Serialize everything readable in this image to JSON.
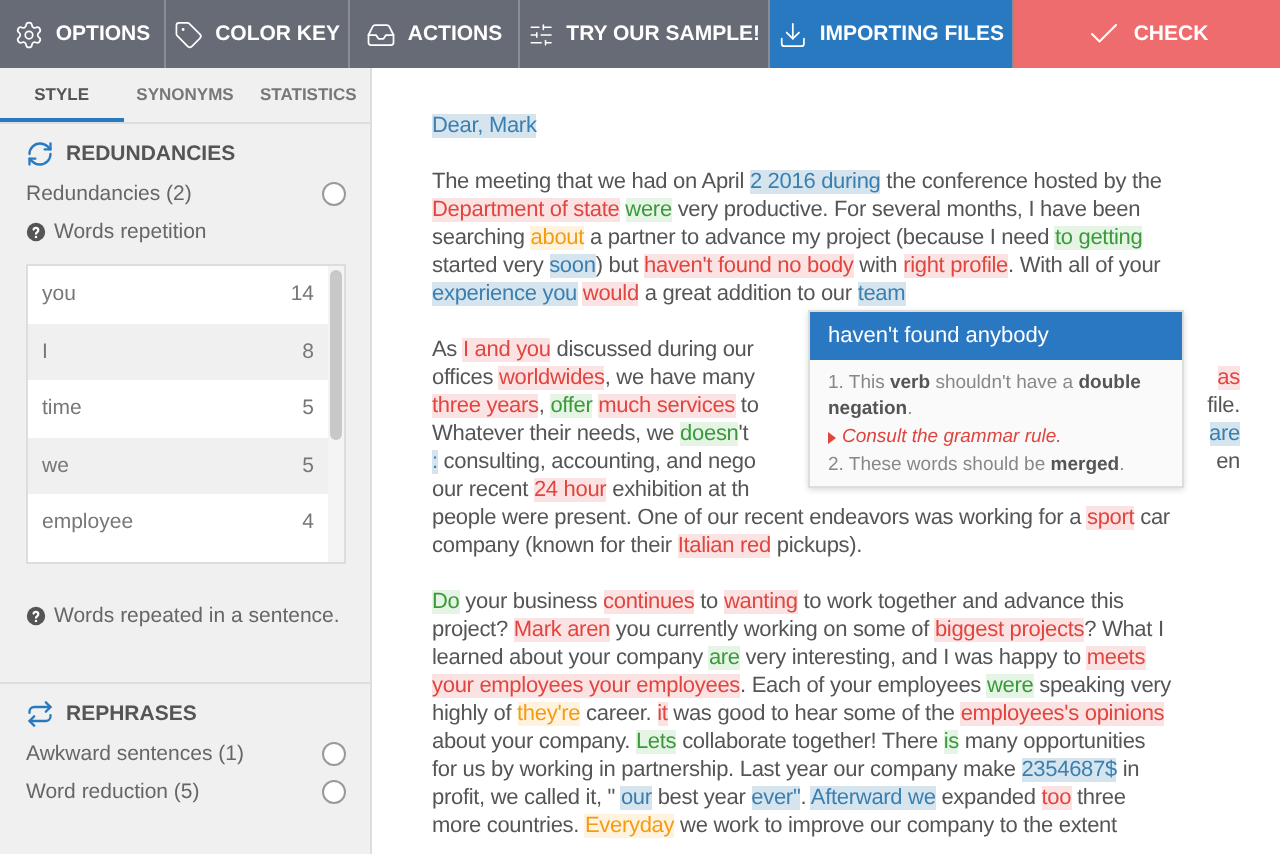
{
  "toolbar": [
    {
      "label": "OPTIONS",
      "kind": "gear"
    },
    {
      "label": "COLOR KEY",
      "kind": "tag"
    },
    {
      "label": "ACTIONS",
      "kind": "tray"
    },
    {
      "label": "TRY OUR SAMPLE!",
      "kind": "sliders"
    },
    {
      "label": "IMPORTING FILES",
      "kind": "download"
    },
    {
      "label": "CHECK",
      "kind": "check"
    }
  ],
  "sidebar": {
    "tabs": [
      {
        "label": "STYLE",
        "selected": true
      },
      {
        "label": "SYNONYMS",
        "selected": false
      },
      {
        "label": "STATISTICS",
        "selected": false
      }
    ],
    "sections": [
      {
        "title": "REDUNDANCIES",
        "kind": "redundancies",
        "options": [
          {
            "label": "Redundancies (2)",
            "checked": false
          }
        ],
        "help": "Words repetition",
        "words": [
          {
            "word": "you",
            "count": "14"
          },
          {
            "word": "I",
            "count": "8"
          },
          {
            "word": "time",
            "count": "5"
          },
          {
            "word": "we",
            "count": "5"
          },
          {
            "word": "employee",
            "count": "4"
          }
        ],
        "note": "Words repeated in a sentence."
      },
      {
        "title": "REPHRASES",
        "kind": "rephrases",
        "options": [
          {
            "label": "Awkward sentences (1)",
            "checked": false
          },
          {
            "label": "Word reduction (5)",
            "checked": false
          }
        ]
      }
    ]
  },
  "document": {
    "paragraphs": [
      {
        "lines": [
          {
            "left": [
              {
                "text": "Dear, Mark",
                "kind": "blue"
              }
            ]
          }
        ]
      },
      {
        "lines": [
          {
            "left": [
              {
                "text": "The meeting that we had on April ",
                "kind": "plain"
              },
              {
                "text": "2 2016 during",
                "kind": "blue"
              },
              {
                "text": " the conference hosted by the",
                "kind": "plain"
              }
            ]
          },
          {
            "left": [
              {
                "text": "Department of state",
                "kind": "red"
              },
              {
                "text": " were",
                "kind": "green"
              },
              {
                "text": " very productive. For several months, I have been",
                "kind": "plain"
              }
            ]
          },
          {
            "left": [
              {
                "text": "searching ",
                "kind": "plain"
              },
              {
                "text": "about",
                "kind": "orange"
              },
              {
                "text": " a partner to advance my project (because I need ",
                "kind": "plain"
              },
              {
                "text": "to getting",
                "kind": "green"
              }
            ]
          },
          {
            "left": [
              {
                "text": "started very ",
                "kind": "plain"
              },
              {
                "text": "soon",
                "kind": "blue"
              },
              {
                "text": ") but ",
                "kind": "plain"
              },
              {
                "text": "haven't found no body",
                "kind": "red"
              },
              {
                "text": " with ",
                "kind": "plain"
              },
              {
                "text": "right profile",
                "kind": "red"
              },
              {
                "text": ". With all of your",
                "kind": "plain"
              }
            ]
          },
          {
            "left": [
              {
                "text": "experience you",
                "kind": "blue"
              },
              {
                "text": " would",
                "kind": "red"
              },
              {
                "text": " a great addition to our ",
                "kind": "plain"
              },
              {
                "text": "team",
                "kind": "blue"
              }
            ]
          }
        ]
      },
      {
        "lines": [
          {
            "left": [
              {
                "text": "As ",
                "kind": "plain"
              },
              {
                "text": "I and you",
                "kind": "red"
              },
              {
                "text": " discussed during our",
                "kind": "plain"
              }
            ]
          },
          {
            "left": [
              {
                "text": "offices ",
                "kind": "plain"
              },
              {
                "text": "worldwides",
                "kind": "red"
              },
              {
                "text": ", we have many",
                "kind": "plain"
              }
            ],
            "right": [
              {
                "text": "as",
                "kind": "red"
              }
            ]
          },
          {
            "left": [
              {
                "text": "three years",
                "kind": "red"
              },
              {
                "text": ", ",
                "kind": "plain"
              },
              {
                "text": "offer",
                "kind": "green"
              },
              {
                "text": " much services",
                "kind": "red"
              },
              {
                "text": " to",
                "kind": "plain"
              }
            ],
            "right": [
              {
                "text": "file.",
                "kind": "plain"
              }
            ]
          },
          {
            "left": [
              {
                "text": "Whatever their needs, we ",
                "kind": "plain"
              },
              {
                "text": "doesn",
                "kind": "green"
              },
              {
                "text": "'t",
                "kind": "plain"
              }
            ],
            "right": [
              {
                "text": "are",
                "kind": "blue"
              }
            ]
          },
          {
            "left": [
              {
                "text": ":",
                "kind": "blue"
              },
              {
                "text": " consulting, accounting, and nego",
                "kind": "plain"
              }
            ],
            "right": [
              {
                "text": "en",
                "kind": "plain"
              }
            ]
          },
          {
            "left": [
              {
                "text": "our recent ",
                "kind": "plain"
              },
              {
                "text": "24 hour",
                "kind": "red"
              },
              {
                "text": " exhibition at th",
                "kind": "plain"
              }
            ]
          },
          {
            "left": [
              {
                "text": "people were present. One of our recent endeavors was working for a ",
                "kind": "plain"
              },
              {
                "text": "sport",
                "kind": "red"
              },
              {
                "text": " car",
                "kind": "plain"
              }
            ]
          },
          {
            "left": [
              {
                "text": "company (known for their ",
                "kind": "plain"
              },
              {
                "text": "Italian red",
                "kind": "red"
              },
              {
                "text": " pickups).",
                "kind": "plain"
              }
            ]
          }
        ]
      },
      {
        "lines": [
          {
            "left": [
              {
                "text": "Do",
                "kind": "green"
              },
              {
                "text": " your business ",
                "kind": "plain"
              },
              {
                "text": "continues",
                "kind": "red"
              },
              {
                "text": " to ",
                "kind": "plain"
              },
              {
                "text": "wanting",
                "kind": "red"
              },
              {
                "text": " to work together and advance this",
                "kind": "plain"
              }
            ]
          },
          {
            "left": [
              {
                "text": "project? ",
                "kind": "plain"
              },
              {
                "text": "Mark aren",
                "kind": "red"
              },
              {
                "text": " you currently working on some of ",
                "kind": "plain"
              },
              {
                "text": "biggest projects",
                "kind": "red"
              },
              {
                "text": "? What I",
                "kind": "plain"
              }
            ]
          },
          {
            "left": [
              {
                "text": "learned about your company ",
                "kind": "plain"
              },
              {
                "text": "are",
                "kind": "green"
              },
              {
                "text": " very interesting, and I was happy to ",
                "kind": "plain"
              },
              {
                "text": "meets",
                "kind": "red"
              }
            ]
          },
          {
            "left": [
              {
                "text": "your employees your employees",
                "kind": "red"
              },
              {
                "text": ". Each of your employees ",
                "kind": "plain"
              },
              {
                "text": "were",
                "kind": "green"
              },
              {
                "text": " speaking very",
                "kind": "plain"
              }
            ]
          },
          {
            "left": [
              {
                "text": "highly of ",
                "kind": "plain"
              },
              {
                "text": "they're",
                "kind": "orange"
              },
              {
                "text": " career. ",
                "kind": "plain"
              },
              {
                "text": "it",
                "kind": "red"
              },
              {
                "text": " was good to hear some of the ",
                "kind": "plain"
              },
              {
                "text": "employees's opinions",
                "kind": "red"
              }
            ]
          },
          {
            "left": [
              {
                "text": "about your company. ",
                "kind": "plain"
              },
              {
                "text": "Lets",
                "kind": "green"
              },
              {
                "text": " collaborate together! There ",
                "kind": "plain"
              },
              {
                "text": "is",
                "kind": "green"
              },
              {
                "text": " many opportunities",
                "kind": "plain"
              }
            ]
          },
          {
            "left": [
              {
                "text": "for us by working in partnership. Last year our company make ",
                "kind": "plain"
              },
              {
                "text": "2354687$",
                "kind": "blue"
              },
              {
                "text": " in",
                "kind": "plain"
              }
            ]
          },
          {
            "left": [
              {
                "text": "profit, we called it, \"",
                "kind": "plain"
              },
              {
                "text": " our",
                "kind": "blue"
              },
              {
                "text": " best year ",
                "kind": "plain"
              },
              {
                "text": "ever\"",
                "kind": "blue"
              },
              {
                "text": ". ",
                "kind": "plain"
              },
              {
                "text": "Afterward we",
                "kind": "blue"
              },
              {
                "text": " expanded ",
                "kind": "plain"
              },
              {
                "text": "too",
                "kind": "red"
              },
              {
                "text": " three",
                "kind": "plain"
              }
            ]
          },
          {
            "left": [
              {
                "text": "more countries. ",
                "kind": "plain"
              },
              {
                "text": "Everyday",
                "kind": "orange"
              },
              {
                "text": " we work to improve our company to the extent",
                "kind": "plain"
              }
            ]
          }
        ]
      }
    ],
    "popup": {
      "title": "haven't found anybody",
      "items": [
        {
          "kind": "note",
          "text": "1. This **verb** shouldn't have a **double negation**."
        },
        {
          "kind": "link",
          "text": "Consult the grammar rule."
        },
        {
          "kind": "note",
          "text": "2. These words should be **merged**."
        }
      ]
    }
  }
}
